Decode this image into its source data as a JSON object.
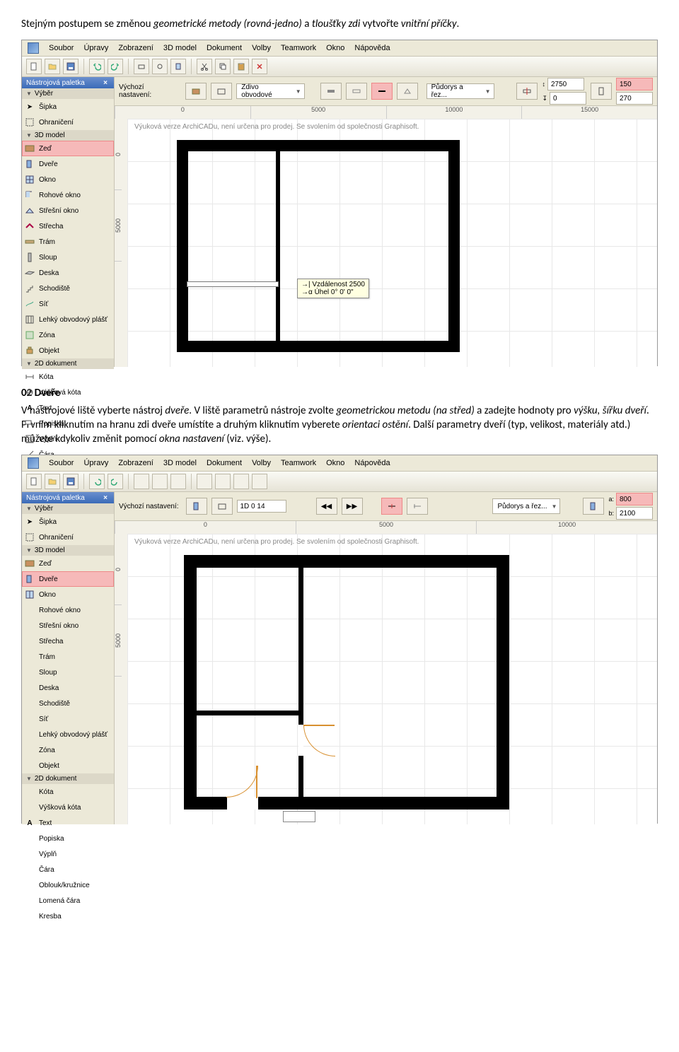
{
  "text": {
    "intro_1a": "Stejným postupem se změnou ",
    "intro_1b": "geometrické metody (rovná-jedno)",
    "intro_1c": " a ",
    "intro_1d": "tloušťky zdi",
    "intro_1e": " vytvořte ",
    "intro_1f": "vnitřní příčky",
    "intro_1g": ".",
    "h2": "02 Dveře",
    "p2_1a": "V nástrojové liště vyberte nástroj ",
    "p2_1b": "dveře",
    "p2_1c": ". V liště parametrů nástroje zvolte ",
    "p2_1d": "geometrickou metodu (na střed)",
    "p2_1e": " a zadejte hodnoty pro ",
    "p2_1f": "výšku, šířku dveří",
    "p2_1g": ". Prvním kliknutím na hranu zdi dveře umístíte a druhým kliknutím vyberete ",
    "p2_1h": "orientaci ostění",
    "p2_1i": ". Další parametry dveří (typ, velikost, materiály atd.) můžete kdykoliv změnit pomocí ",
    "p2_1j": "okna nastavení",
    "p2_1k": " (viz. výše)."
  },
  "menu": {
    "items": [
      "Soubor",
      "Úpravy",
      "Zobrazení",
      "3D model",
      "Dokument",
      "Volby",
      "Teamwork",
      "Okno",
      "Nápověda"
    ]
  },
  "palette": {
    "title": "Nástrojová paletka",
    "sec_vyber": "Výběr",
    "sipka": "Šipka",
    "ohraniceni": "Ohraničení",
    "sec_3d": "3D model",
    "zed": "Zeď",
    "dvere": "Dveře",
    "okno": "Okno",
    "rohove_okno": "Rohové okno",
    "stresni_okno": "Střešní okno",
    "strecha": "Střecha",
    "tram": "Trám",
    "sloup": "Sloup",
    "deska": "Deska",
    "schodiste": "Schodiště",
    "sit": "Síť",
    "lop": "Lehký obvodový plášť",
    "zona": "Zóna",
    "objekt": "Objekt",
    "sec_2d": "2D dokument",
    "kota": "Kóta",
    "vyskova_kota": "Výšková kóta",
    "text": "Text",
    "popiska": "Popiska",
    "vypln": "Výplň",
    "cara": "Čára",
    "oblouk": "Oblouk/kružnice",
    "lomena": "Lomená čára",
    "kresba": "Kresba"
  },
  "optbar1": {
    "label": "Výchozí nastavení:",
    "dropdown": "Zdivo obvodové",
    "viewdd": "Půdorys a řez...",
    "f1": "2750",
    "f2": "0",
    "f3": "150",
    "f4": "270"
  },
  "optbar2": {
    "label": "Výchozí nastavení:",
    "id": "1D 0 14",
    "viewdd": "Půdorys a řez...",
    "fa": "800",
    "fb": "2100",
    "fa_lbl": "a:",
    "fb_lbl": "b:"
  },
  "ruler1": {
    "ticks": [
      "0",
      "5000",
      "10000",
      "15000"
    ]
  },
  "ruler1v": {
    "ticks": [
      "0",
      "5000"
    ]
  },
  "ruler2": {
    "ticks": [
      "0",
      "5000",
      "10000"
    ]
  },
  "ruler2v": {
    "ticks": [
      "0",
      "5000"
    ]
  },
  "canvas": {
    "watermark": "Výuková verze ArchiCADu, není určena pro prodej. Se svolením od společnosti Graphisoft.",
    "tooltip_l1": "Vzdálenost  2500",
    "tooltip_l2": "Úhel        0° 0' 0\""
  }
}
